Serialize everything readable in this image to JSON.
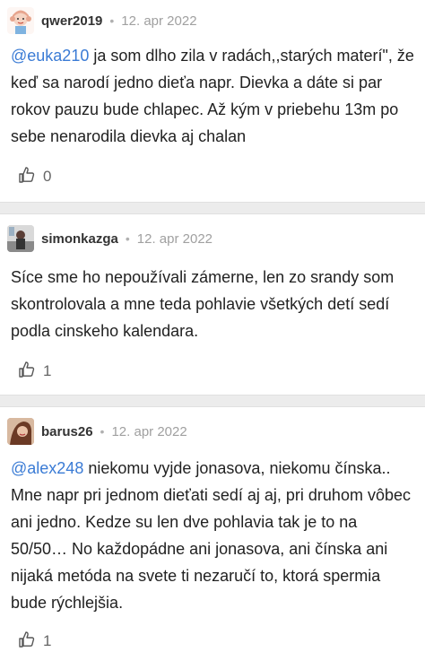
{
  "comments": [
    {
      "username": "qwer2019",
      "date": "12. apr 2022",
      "mention": "@euka210",
      "text": " ja som dlho zila v radách,,starých materí\", že keď sa narodí jedno dieťa napr. Dievka a dáte si par rokov pauzu bude chlapec. Až kým v priebehu 13m po sebe nenarodila dievka aj chalan",
      "likes": "0",
      "avatar": "cartoon-girl-avatar"
    },
    {
      "username": "simonkazga",
      "date": "12. apr 2022",
      "mention": "",
      "text": "Síce sme ho nepoužívali zámerne, len zo srandy som skontrolovala a mne teda pohlavie všetkých detí sedí podla cinskeho kalendara.",
      "likes": "1",
      "avatar": "photo-avatar"
    },
    {
      "username": "barus26",
      "date": "12. apr 2022",
      "mention": "@alex248",
      "text": " niekomu vyjde jonasova, niekomu čínska.. Mne napr pri jednom dieťati sedí aj aj, pri druhom vôbec ani jedno. Kedze su len dve pohlavia tak je to na 50/50… No každopádne ani jonasova, ani čínska ani nijaká metóda na svete ti nezaručí to, ktorá spermia bude rýchlejšia.",
      "likes": "1",
      "avatar": "photo-avatar"
    }
  ],
  "colors": {
    "mention": "#3a7bd5",
    "separator": "#ececec"
  }
}
